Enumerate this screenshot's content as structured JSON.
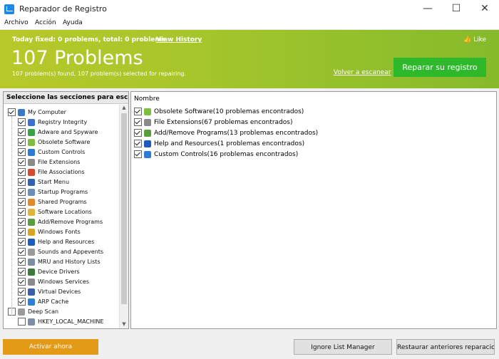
{
  "window": {
    "title": "Reparador de Registro",
    "controls": [
      "—",
      "☐",
      "✕"
    ]
  },
  "menu": [
    "Archivo",
    "Acción",
    "Ayuda"
  ],
  "banner": {
    "today_fixed": "Today fixed: 0 problems, total: 0 problems.",
    "view_history": "View History",
    "headline": "107 Problems",
    "summary": "107 problem(s) found, 107 problem(s) selected for repairing.",
    "rescan": "Volver a escanear",
    "like": "Like",
    "repair_button": "Reparar su registro"
  },
  "left_panel": {
    "header": "Seleccione las secciones para esca",
    "root": "My Computer",
    "items": [
      {
        "label": "Registry Integrity",
        "icon": "registry-icon",
        "color": "#3b6fd1"
      },
      {
        "label": "Adware and Spyware",
        "icon": "adware-icon",
        "color": "#3aa34a"
      },
      {
        "label": "Obsolete Software",
        "icon": "obsolete-software-icon",
        "color": "#7cbf3f"
      },
      {
        "label": "Custom Controls",
        "icon": "custom-controls-icon",
        "color": "#2d7bd6"
      },
      {
        "label": "File Extensions",
        "icon": "file-extensions-icon",
        "color": "#8a8a8a"
      },
      {
        "label": "File Associations",
        "icon": "file-associations-icon",
        "color": "#d84a2b"
      },
      {
        "label": "Start Menu",
        "icon": "start-menu-icon",
        "color": "#2f62b5"
      },
      {
        "label": "Startup Programs",
        "icon": "startup-programs-icon",
        "color": "#6b8fb8"
      },
      {
        "label": "Shared Programs",
        "icon": "shared-programs-icon",
        "color": "#e08a2a"
      },
      {
        "label": "Software Locations",
        "icon": "software-locations-icon",
        "color": "#e0b33a"
      },
      {
        "label": "Add/Remove Programs",
        "icon": "add-remove-programs-icon",
        "color": "#5a9d3c"
      },
      {
        "label": "Windows Fonts",
        "icon": "windows-fonts-icon",
        "color": "#d9a520"
      },
      {
        "label": "Help and Resources",
        "icon": "help-icon",
        "color": "#1e5bbf"
      },
      {
        "label": "Sounds and Appevents",
        "icon": "sounds-icon",
        "color": "#9a9a9a"
      },
      {
        "label": "MRU and History Lists",
        "icon": "mru-history-icon",
        "color": "#7b8ea6"
      },
      {
        "label": "Device Drivers",
        "icon": "device-drivers-icon",
        "color": "#3c7a3c"
      },
      {
        "label": "Windows Services",
        "icon": "windows-services-icon",
        "color": "#8a8a8a"
      },
      {
        "label": "Virtual Devices",
        "icon": "virtual-devices-icon",
        "color": "#3a5ea8"
      },
      {
        "label": "ARP Cache",
        "icon": "arp-cache-icon",
        "color": "#2f7fd6"
      }
    ],
    "deep_scan": "Deep Scan",
    "deep_scan_child": "HKEY_LOCAL_MACHINE"
  },
  "right_panel": {
    "column_header": "Nombre",
    "rows": [
      {
        "label": "Obsolete Software(10 problemas encontrados)",
        "icon": "obsolete-software-icon",
        "color": "#7cbf3f"
      },
      {
        "label": "File Extensions(67 problemas encontrados)",
        "icon": "file-extensions-icon",
        "color": "#8a8a8a"
      },
      {
        "label": "Add/Remove Programs(13 problemas encontrados)",
        "icon": "add-remove-programs-icon",
        "color": "#5a9d3c"
      },
      {
        "label": "Help and Resources(1 problemas encontrados)",
        "icon": "help-icon",
        "color": "#1e5bbf"
      },
      {
        "label": "Custom Controls(16 problemas encontrados)",
        "icon": "custom-controls-icon",
        "color": "#2d7bd6"
      }
    ]
  },
  "footer": {
    "activate": "Activar ahora",
    "ignore": "Ignore List Manager",
    "restore": "Restaurar anteriores reparacio..."
  }
}
